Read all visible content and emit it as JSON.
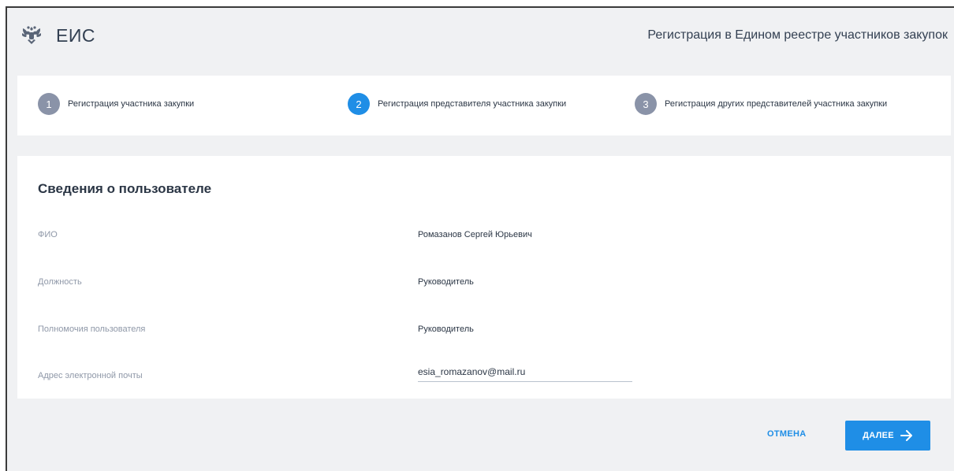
{
  "header": {
    "app_name": "ЕИС",
    "page_title": "Регистрация в Едином реестре участников закупок",
    "emblem_icon": "double-headed-eagle-icon"
  },
  "stepper": {
    "steps": [
      {
        "number": "1",
        "label": "Регистрация участника закупки",
        "active": false
      },
      {
        "number": "2",
        "label": "Регистрация представителя участника закупки",
        "active": true
      },
      {
        "number": "3",
        "label": "Регистрация других представителей участника закупки",
        "active": false
      }
    ]
  },
  "form": {
    "title": "Сведения о пользователе",
    "fields": {
      "fio": {
        "label": "ФИО",
        "value": "Ромазанов Сергей Юрьевич"
      },
      "position": {
        "label": "Должность",
        "value": "Руководитель"
      },
      "authority": {
        "label": "Полномочия пользователя",
        "value": "Руководитель"
      },
      "email": {
        "label": "Адрес электронной почты",
        "value": "esia_romazanov@mail.ru"
      }
    }
  },
  "footer": {
    "cancel_label": "ОТМЕНА",
    "next_label": "ДАЛЕЕ",
    "next_icon": "arrow-right-icon"
  },
  "colors": {
    "accent": "#1f8ee6",
    "inactive_step": "#8a93a8",
    "background": "#f0f1f3"
  }
}
